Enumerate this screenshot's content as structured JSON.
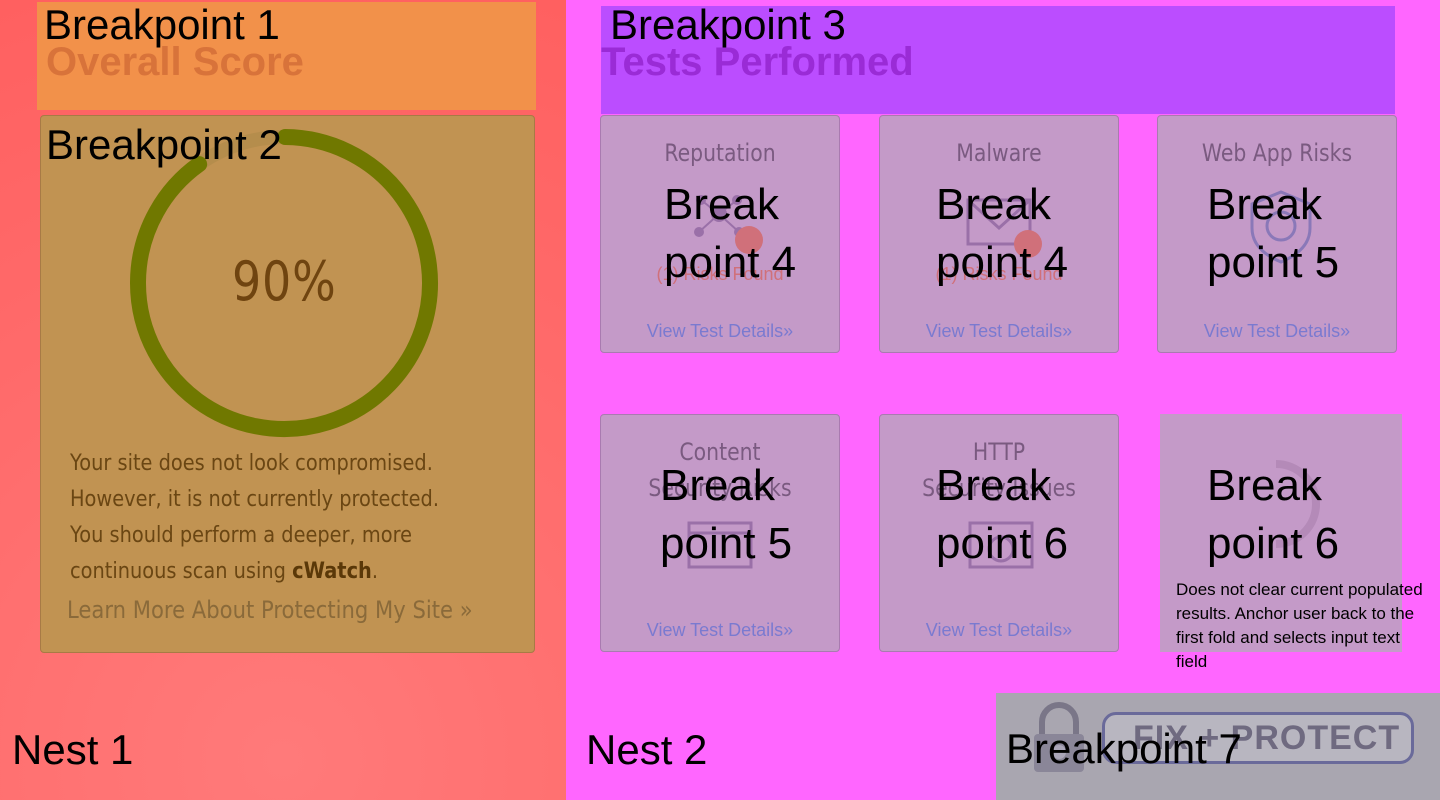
{
  "nest1": {
    "label": "Nest 1",
    "breakpoint1": {
      "label": "Breakpoint 1",
      "title": "Overall Score"
    },
    "breakpoint2": {
      "label": "Breakpoint 2",
      "score": "90%",
      "score_fraction": 0.9,
      "description_lines": [
        "Your site does not look compromised.",
        "However, it is not currently protected.",
        "You should perform a deeper, more"
      ],
      "description_last_prefix": "continuous scan using ",
      "description_last_bold": "cWatch",
      "description_last_suffix": ".",
      "learn_more": "Learn More About Protecting My Site »"
    }
  },
  "nest2": {
    "label": "Nest 2",
    "breakpoint3": {
      "label": "Breakpoint 3",
      "title": "Tests Performed"
    },
    "cards": [
      {
        "title": "Reputation",
        "risk": "(1) Risks Found",
        "link": "View Test Details»",
        "overlay": [
          "Break",
          "point 4"
        ]
      },
      {
        "title": "Malware",
        "risk": "(1) Risks Found",
        "link": "View Test Details»",
        "overlay": [
          "Break",
          "point 4"
        ]
      },
      {
        "title": "Web App Risks",
        "link": "View Test Details»",
        "overlay": [
          "Break",
          "point 5"
        ]
      },
      {
        "title_lines": [
          "Content",
          "Security Risks"
        ],
        "link": "View Test Details»",
        "overlay": [
          "Break",
          "point 5"
        ]
      },
      {
        "title_lines": [
          "HTTP",
          "Security Issues"
        ],
        "link": "View Test Details»",
        "overlay": [
          "Break",
          "point 6"
        ]
      }
    ],
    "rescan": {
      "overlay": [
        "Break",
        "point 6"
      ],
      "note": "Does not clear current populated results. Anchor user back to the first fold and selects input text field"
    },
    "breakpoint7": {
      "label": "Breakpoint 7",
      "button": "FIX + PROTECT NOW"
    }
  },
  "colors": {
    "nest1_bg": "#ff6a6a",
    "nest2_bg": "#ff66ff",
    "bp1_bg": "#f2914a",
    "bp2_bg": "#c19352",
    "bp3_bg": "#bb4dff",
    "gauge": "#707800",
    "card_bg": "#c49ac8"
  }
}
